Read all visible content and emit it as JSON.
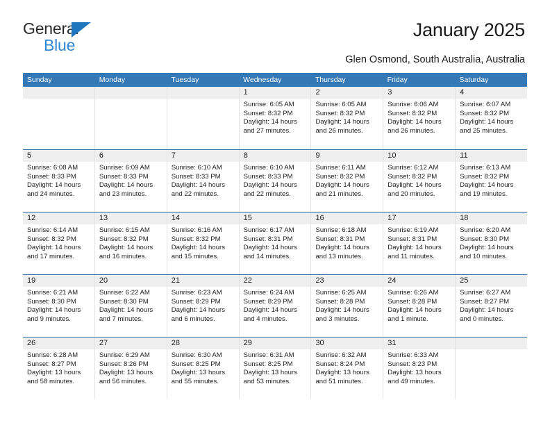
{
  "brand": {
    "line1": "General",
    "line2": "Blue",
    "triangle_color": "#1f76bd",
    "text_color": "#2b2b2b",
    "blue_text_color": "#2f87d6"
  },
  "header": {
    "title": "January 2025",
    "location": "Glen Osmond, South Australia, Australia"
  },
  "theme": {
    "header_blue": "#3479b5",
    "row_rule_blue": "#2e6da8",
    "day_band_gray": "#efefef"
  },
  "weekdays": [
    "Sunday",
    "Monday",
    "Tuesday",
    "Wednesday",
    "Thursday",
    "Friday",
    "Saturday"
  ],
  "weeks": [
    [
      {
        "day": "",
        "sunrise": "",
        "sunset": "",
        "daylight1": "",
        "daylight2": ""
      },
      {
        "day": "",
        "sunrise": "",
        "sunset": "",
        "daylight1": "",
        "daylight2": ""
      },
      {
        "day": "",
        "sunrise": "",
        "sunset": "",
        "daylight1": "",
        "daylight2": ""
      },
      {
        "day": "1",
        "sunrise": "Sunrise: 6:05 AM",
        "sunset": "Sunset: 8:32 PM",
        "daylight1": "Daylight: 14 hours",
        "daylight2": "and 27 minutes."
      },
      {
        "day": "2",
        "sunrise": "Sunrise: 6:05 AM",
        "sunset": "Sunset: 8:32 PM",
        "daylight1": "Daylight: 14 hours",
        "daylight2": "and 26 minutes."
      },
      {
        "day": "3",
        "sunrise": "Sunrise: 6:06 AM",
        "sunset": "Sunset: 8:32 PM",
        "daylight1": "Daylight: 14 hours",
        "daylight2": "and 26 minutes."
      },
      {
        "day": "4",
        "sunrise": "Sunrise: 6:07 AM",
        "sunset": "Sunset: 8:32 PM",
        "daylight1": "Daylight: 14 hours",
        "daylight2": "and 25 minutes."
      }
    ],
    [
      {
        "day": "5",
        "sunrise": "Sunrise: 6:08 AM",
        "sunset": "Sunset: 8:33 PM",
        "daylight1": "Daylight: 14 hours",
        "daylight2": "and 24 minutes."
      },
      {
        "day": "6",
        "sunrise": "Sunrise: 6:09 AM",
        "sunset": "Sunset: 8:33 PM",
        "daylight1": "Daylight: 14 hours",
        "daylight2": "and 23 minutes."
      },
      {
        "day": "7",
        "sunrise": "Sunrise: 6:10 AM",
        "sunset": "Sunset: 8:33 PM",
        "daylight1": "Daylight: 14 hours",
        "daylight2": "and 22 minutes."
      },
      {
        "day": "8",
        "sunrise": "Sunrise: 6:10 AM",
        "sunset": "Sunset: 8:33 PM",
        "daylight1": "Daylight: 14 hours",
        "daylight2": "and 22 minutes."
      },
      {
        "day": "9",
        "sunrise": "Sunrise: 6:11 AM",
        "sunset": "Sunset: 8:32 PM",
        "daylight1": "Daylight: 14 hours",
        "daylight2": "and 21 minutes."
      },
      {
        "day": "10",
        "sunrise": "Sunrise: 6:12 AM",
        "sunset": "Sunset: 8:32 PM",
        "daylight1": "Daylight: 14 hours",
        "daylight2": "and 20 minutes."
      },
      {
        "day": "11",
        "sunrise": "Sunrise: 6:13 AM",
        "sunset": "Sunset: 8:32 PM",
        "daylight1": "Daylight: 14 hours",
        "daylight2": "and 19 minutes."
      }
    ],
    [
      {
        "day": "12",
        "sunrise": "Sunrise: 6:14 AM",
        "sunset": "Sunset: 8:32 PM",
        "daylight1": "Daylight: 14 hours",
        "daylight2": "and 17 minutes."
      },
      {
        "day": "13",
        "sunrise": "Sunrise: 6:15 AM",
        "sunset": "Sunset: 8:32 PM",
        "daylight1": "Daylight: 14 hours",
        "daylight2": "and 16 minutes."
      },
      {
        "day": "14",
        "sunrise": "Sunrise: 6:16 AM",
        "sunset": "Sunset: 8:32 PM",
        "daylight1": "Daylight: 14 hours",
        "daylight2": "and 15 minutes."
      },
      {
        "day": "15",
        "sunrise": "Sunrise: 6:17 AM",
        "sunset": "Sunset: 8:31 PM",
        "daylight1": "Daylight: 14 hours",
        "daylight2": "and 14 minutes."
      },
      {
        "day": "16",
        "sunrise": "Sunrise: 6:18 AM",
        "sunset": "Sunset: 8:31 PM",
        "daylight1": "Daylight: 14 hours",
        "daylight2": "and 13 minutes."
      },
      {
        "day": "17",
        "sunrise": "Sunrise: 6:19 AM",
        "sunset": "Sunset: 8:31 PM",
        "daylight1": "Daylight: 14 hours",
        "daylight2": "and 11 minutes."
      },
      {
        "day": "18",
        "sunrise": "Sunrise: 6:20 AM",
        "sunset": "Sunset: 8:30 PM",
        "daylight1": "Daylight: 14 hours",
        "daylight2": "and 10 minutes."
      }
    ],
    [
      {
        "day": "19",
        "sunrise": "Sunrise: 6:21 AM",
        "sunset": "Sunset: 8:30 PM",
        "daylight1": "Daylight: 14 hours",
        "daylight2": "and 9 minutes."
      },
      {
        "day": "20",
        "sunrise": "Sunrise: 6:22 AM",
        "sunset": "Sunset: 8:30 PM",
        "daylight1": "Daylight: 14 hours",
        "daylight2": "and 7 minutes."
      },
      {
        "day": "21",
        "sunrise": "Sunrise: 6:23 AM",
        "sunset": "Sunset: 8:29 PM",
        "daylight1": "Daylight: 14 hours",
        "daylight2": "and 6 minutes."
      },
      {
        "day": "22",
        "sunrise": "Sunrise: 6:24 AM",
        "sunset": "Sunset: 8:29 PM",
        "daylight1": "Daylight: 14 hours",
        "daylight2": "and 4 minutes."
      },
      {
        "day": "23",
        "sunrise": "Sunrise: 6:25 AM",
        "sunset": "Sunset: 8:28 PM",
        "daylight1": "Daylight: 14 hours",
        "daylight2": "and 3 minutes."
      },
      {
        "day": "24",
        "sunrise": "Sunrise: 6:26 AM",
        "sunset": "Sunset: 8:28 PM",
        "daylight1": "Daylight: 14 hours",
        "daylight2": "and 1 minute."
      },
      {
        "day": "25",
        "sunrise": "Sunrise: 6:27 AM",
        "sunset": "Sunset: 8:27 PM",
        "daylight1": "Daylight: 14 hours",
        "daylight2": "and 0 minutes."
      }
    ],
    [
      {
        "day": "26",
        "sunrise": "Sunrise: 6:28 AM",
        "sunset": "Sunset: 8:27 PM",
        "daylight1": "Daylight: 13 hours",
        "daylight2": "and 58 minutes."
      },
      {
        "day": "27",
        "sunrise": "Sunrise: 6:29 AM",
        "sunset": "Sunset: 8:26 PM",
        "daylight1": "Daylight: 13 hours",
        "daylight2": "and 56 minutes."
      },
      {
        "day": "28",
        "sunrise": "Sunrise: 6:30 AM",
        "sunset": "Sunset: 8:25 PM",
        "daylight1": "Daylight: 13 hours",
        "daylight2": "and 55 minutes."
      },
      {
        "day": "29",
        "sunrise": "Sunrise: 6:31 AM",
        "sunset": "Sunset: 8:25 PM",
        "daylight1": "Daylight: 13 hours",
        "daylight2": "and 53 minutes."
      },
      {
        "day": "30",
        "sunrise": "Sunrise: 6:32 AM",
        "sunset": "Sunset: 8:24 PM",
        "daylight1": "Daylight: 13 hours",
        "daylight2": "and 51 minutes."
      },
      {
        "day": "31",
        "sunrise": "Sunrise: 6:33 AM",
        "sunset": "Sunset: 8:23 PM",
        "daylight1": "Daylight: 13 hours",
        "daylight2": "and 49 minutes."
      },
      {
        "day": "",
        "sunrise": "",
        "sunset": "",
        "daylight1": "",
        "daylight2": ""
      }
    ]
  ]
}
